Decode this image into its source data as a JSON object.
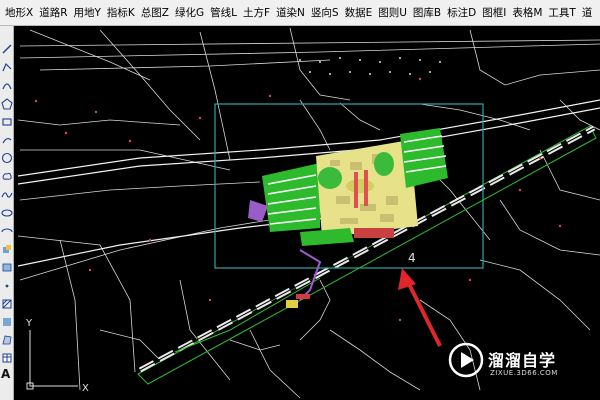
{
  "menu": {
    "items": [
      "地形X",
      "道路R",
      "用地Y",
      "指标K",
      "总图Z",
      "绿化G",
      "管线L",
      "土方F",
      "道染N",
      "竖向S",
      "数据E",
      "图则U",
      "图库B",
      "标注D",
      "图框I",
      "表格M",
      "工具T",
      "道"
    ]
  },
  "toolbar": {
    "tools": [
      "line-icon",
      "polyline-icon",
      "arc-icon",
      "polygon-icon",
      "rectangle-icon",
      "arc2-icon",
      "circle-icon",
      "revcloud-icon",
      "spline-icon",
      "ellipse-icon",
      "ellipse-arc-icon",
      "insert-block-icon",
      "make-block-icon",
      "point-icon",
      "hatch-icon",
      "gradient-icon",
      "region-icon",
      "table-icon",
      "mtext-icon"
    ],
    "mtext_label": "A"
  },
  "drawing": {
    "annotation_number": "4",
    "ucs_x_label": "X",
    "ucs_y_label": "Y"
  },
  "watermark": {
    "title": "溜溜自学",
    "url": "ZIXUE.3D66.COM"
  },
  "colors": {
    "canvas_bg": "#000000",
    "selection_rect": "#2fa7a7",
    "green_fields": "#2dbb2d",
    "arrow_red": "#e0262b",
    "road_outline": "#2fbf2f"
  }
}
